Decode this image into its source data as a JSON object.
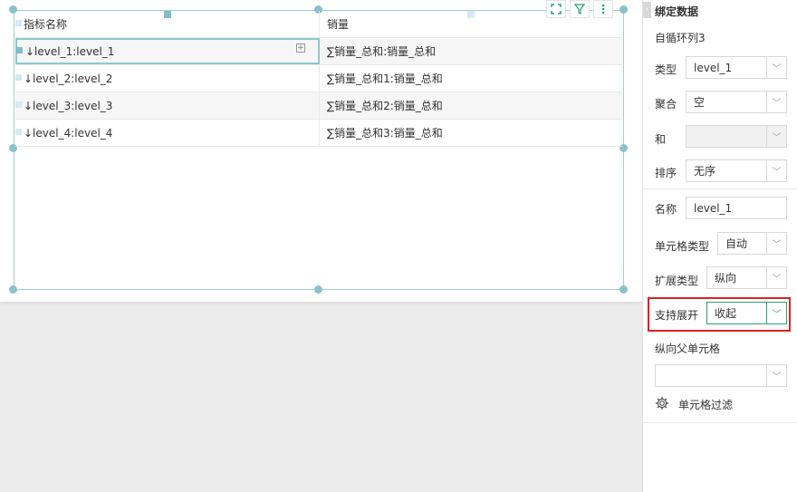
{
  "table": {
    "headers": [
      "指标名称",
      "销量"
    ],
    "rows": [
      [
        "↓level_1:level_1",
        "∑销量_总和:销量_总和"
      ],
      [
        "↓level_2:level_2",
        "∑销量_总和1:销量_总和"
      ],
      [
        "↓level_3:level_3",
        "∑销量_总和2:销量_总和"
      ],
      [
        "↓level_4:level_4",
        "∑销量_总和3:销量_总和"
      ]
    ],
    "expand_symbol": "+"
  },
  "toolbar": {
    "expand_icon": "expand-icon",
    "filter_icon": "filter-icon",
    "more_icon": "more-icon"
  },
  "panel": {
    "collapse_glyph": "›",
    "title": "绑定数据",
    "subtitle": "自循环列3",
    "type_label": "类型",
    "type_value": "level_1",
    "aggregate_label": "聚合",
    "aggregate_value": "空",
    "and_label": "和",
    "and_value": "",
    "sort_label": "排序",
    "sort_value": "无序",
    "name_label": "名称",
    "name_value": "level_1",
    "cell_type_label": "单元格类型",
    "cell_type_value": "自动",
    "expand_type_label": "扩展类型",
    "expand_type_value": "纵向",
    "support_expand_label": "支持展开",
    "support_expand_value": "收起",
    "parent_cell_label": "纵向父单元格",
    "parent_cell_value": "",
    "cell_filter_label": "单元格过滤",
    "dropdown_glyph": "﹀"
  },
  "colors": {
    "accent": "#26a17a",
    "selection": "#88c2cc",
    "highlight": "#dd2222"
  }
}
